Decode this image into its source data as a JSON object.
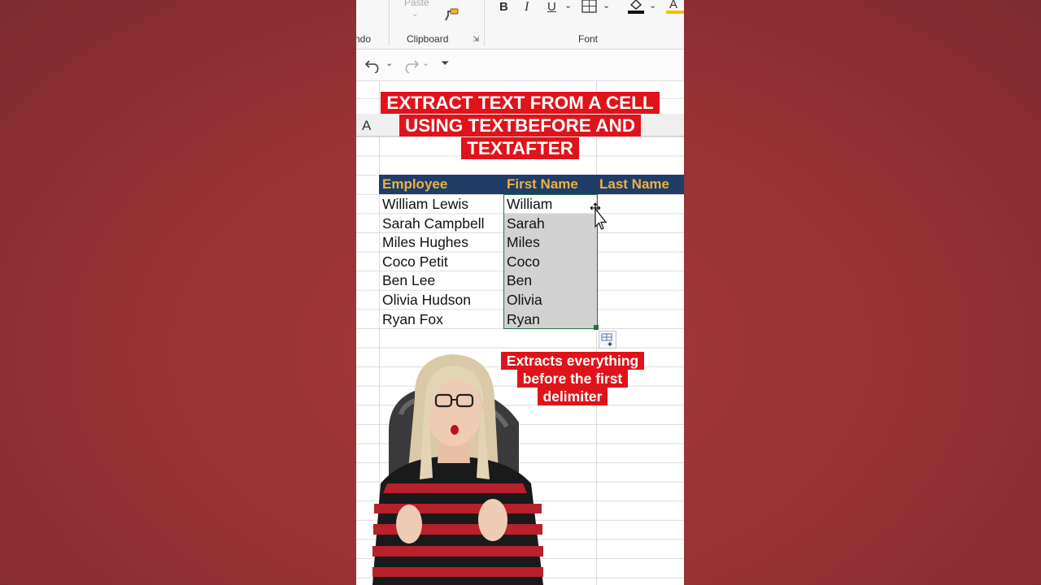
{
  "ribbon": {
    "paste_label": "Paste",
    "undo_group_label": "ndo",
    "clipboard_label": "Clipboard",
    "font_label": "Font",
    "bold_label": "B",
    "italic_label": "I",
    "underline_label": "U",
    "font_color_label": "A"
  },
  "sheet": {
    "column_a": "A",
    "headers": {
      "employee": "Employee",
      "first_name": "First Name",
      "last_name": "Last Name"
    },
    "rows": [
      {
        "employee": "William Lewis",
        "first": "William"
      },
      {
        "employee": "Sarah Campbell",
        "first": "Sarah"
      },
      {
        "employee": "Miles Hughes",
        "first": "Miles"
      },
      {
        "employee": "Coco Petit",
        "first": "Coco"
      },
      {
        "employee": "Ben Lee",
        "first": "Ben"
      },
      {
        "employee": "Olivia Hudson",
        "first": "Olivia"
      },
      {
        "employee": "Ryan Fox",
        "first": "Ryan"
      }
    ]
  },
  "overlay": {
    "title": "EXTRACT TEXT FROM A CELL USING TEXTBEFORE AND TEXTAFTER",
    "note": "Extracts everything before the first delimiter"
  },
  "colors": {
    "background": "#963236",
    "banner": "#e0131b",
    "header_fill": "#1f3d67",
    "header_text": "#f0b040",
    "selection": "#217346"
  }
}
